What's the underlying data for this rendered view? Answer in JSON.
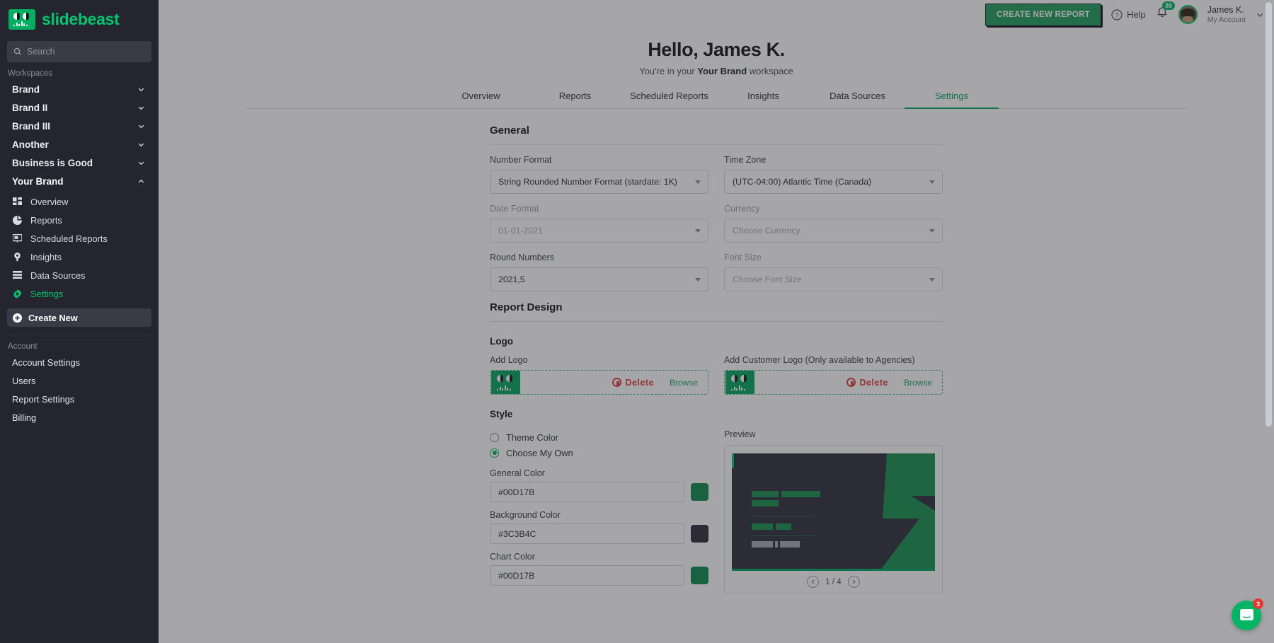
{
  "brand": {
    "name": "slidebeast",
    "logo_icon": "beast-logo-icon"
  },
  "sidebar": {
    "search": {
      "placeholder": "Search",
      "value": "",
      "icon": "search-icon"
    },
    "workspaces_label": "Workspaces",
    "workspaces": [
      {
        "label": "Brand",
        "expanded": false
      },
      {
        "label": "Brand II",
        "expanded": false
      },
      {
        "label": "Brand III",
        "expanded": false
      },
      {
        "label": "Another",
        "expanded": false
      },
      {
        "label": "Business is Good",
        "expanded": false
      },
      {
        "label": "Your Brand",
        "expanded": true
      }
    ],
    "workspace_nav": [
      {
        "label": "Overview",
        "icon": "grid-icon",
        "active": false
      },
      {
        "label": "Reports",
        "icon": "pie-chart-icon",
        "active": false
      },
      {
        "label": "Scheduled Reports",
        "icon": "presentation-icon",
        "active": false
      },
      {
        "label": "Insights",
        "icon": "lightbulb-icon",
        "active": false
      },
      {
        "label": "Data Sources",
        "icon": "database-icon",
        "active": false
      },
      {
        "label": "Settings",
        "icon": "gear-icon",
        "active": true
      }
    ],
    "create_new": {
      "label": "Create New",
      "icon": "plus-circle-icon"
    },
    "account_label": "Account",
    "account_items": [
      {
        "label": "Account Settings"
      },
      {
        "label": "Users"
      },
      {
        "label": "Report Settings"
      },
      {
        "label": "Billing"
      }
    ]
  },
  "topbar": {
    "cta_label": "CREATE NEW REPORT",
    "help_label": "Help",
    "help_icon": "question-circle-icon",
    "bell_icon": "bell-icon",
    "notification_count": "39",
    "avatar": "user-avatar",
    "user_name": "James K.",
    "user_sub": "My Account",
    "user_chevron": "chevron-down-icon"
  },
  "header": {
    "greeting": "Hello, James K.",
    "subtitle_prefix": "You're in your ",
    "workspace_name": "Your Brand",
    "subtitle_suffix": " workspace"
  },
  "tabs": [
    {
      "label": "Overview",
      "active": false
    },
    {
      "label": "Reports",
      "active": false
    },
    {
      "label": "Scheduled Reports",
      "active": false
    },
    {
      "label": "Insights",
      "active": false
    },
    {
      "label": "Data Sources",
      "active": false
    },
    {
      "label": "Settings",
      "active": true
    }
  ],
  "general": {
    "title": "General",
    "number_format": {
      "label": "Number Format",
      "value": "String Rounded Number Format (stardate: 1K)"
    },
    "time_zone": {
      "label": "Time Zone",
      "value": "(UTC-04:00) Atlantic Time (Canada)"
    },
    "date_format": {
      "label": "Date Format",
      "value": "01-01-2021"
    },
    "currency": {
      "label": "Currency",
      "placeholder": "Choose Currency"
    },
    "round_numbers": {
      "label": "Round Numbers",
      "value": "2021,5"
    },
    "font_size": {
      "label": "Font Size",
      "placeholder": "Choose Font Size"
    }
  },
  "report_design": {
    "title": "Report Design",
    "logo": {
      "title": "Logo",
      "add_logo_label": "Add Logo",
      "add_customer_logo_label": "Add Customer Logo (Only available to Agencies)",
      "delete_label": "Delete",
      "browse_label": "Browse"
    },
    "style": {
      "title": "Style",
      "theme_color_label": "Theme Color",
      "choose_my_own_label": "Choose My Own",
      "selected": "Choose My Own",
      "general_color": {
        "label": "General Color",
        "value": "#00D17B"
      },
      "background_color": {
        "label": "Background Color",
        "value": "#3C3B4C"
      },
      "chart_color": {
        "label": "Chart Color",
        "value": "#00D17B"
      }
    },
    "preview": {
      "label": "Preview",
      "page_indicator": "1 / 4",
      "prev_icon": "chevron-left-icon",
      "next_icon": "chevron-right-icon"
    }
  },
  "intercom": {
    "icon": "chat-bubble-icon",
    "badge": "3"
  }
}
